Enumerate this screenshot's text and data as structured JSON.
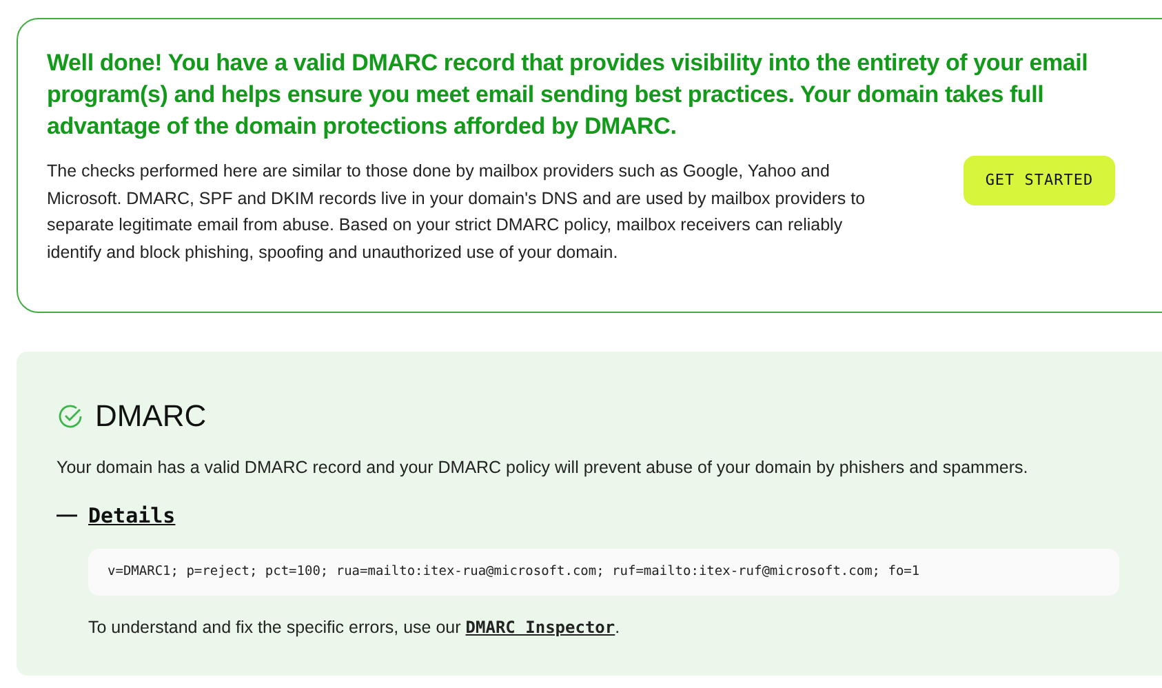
{
  "summary": {
    "headline": "Well done! You have a valid DMARC record that provides visibility into the entirety of your email program(s) and helps ensure you meet email sending best practices. Your domain takes full advantage of the domain protections afforded by DMARC.",
    "body": "The checks performed here are similar to those done by mailbox providers such as Google, Yahoo and Microsoft. DMARC, SPF and DKIM records live in your domain's DNS and are used by mailbox providers to separate legitimate email from abuse. Based on your strict DMARC policy, mailbox receivers can reliably identify and block phishing, spoofing and unauthorized use of your domain.",
    "button": "GET STARTED"
  },
  "dmarc": {
    "title": "DMARC",
    "passed": true,
    "description": "Your domain has a valid DMARC record and your DMARC policy will prevent abuse of your domain by phishers and spammers.",
    "details": {
      "toggle": "—",
      "label": "Details",
      "expanded": true,
      "record": "v=DMARC1; p=reject; pct=100; rua=mailto:itex-rua@microsoft.com; ruf=mailto:itex-ruf@microsoft.com; fo=1",
      "hint_prefix": "To understand and fix the specific errors, use our ",
      "hint_link": "DMARC Inspector",
      "hint_suffix": "."
    }
  }
}
